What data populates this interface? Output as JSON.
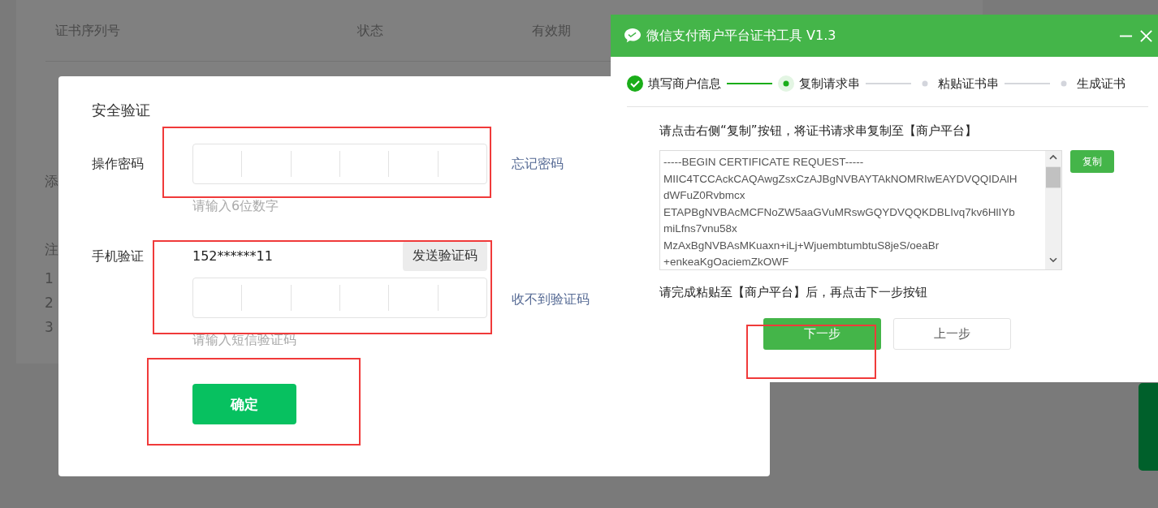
{
  "background": {
    "columns": [
      "证书序列号",
      "状态",
      "有效期"
    ],
    "fragments": [
      "添",
      "注",
      "1",
      "2",
      "3"
    ]
  },
  "dialog": {
    "title": "安全验证",
    "password": {
      "label": "操作密码",
      "hint": "请输入6位数字",
      "link": "忘记密码"
    },
    "phone": {
      "label": "手机验证",
      "number": "152******11",
      "send_button": "发送验证码",
      "hint": "请输入短信验证码",
      "link": "收不到验证码"
    },
    "confirm_button": "确定"
  },
  "tool": {
    "title": "微信支付商户平台证书工具 V1.3",
    "steps": [
      {
        "label": "填写商户信息",
        "completed": true,
        "selected": false
      },
      {
        "label": "复制请求串",
        "completed": false,
        "selected": true
      },
      {
        "label": "粘贴证书串",
        "completed": false,
        "selected": false
      },
      {
        "label": "生成证书",
        "completed": false,
        "selected": false
      }
    ],
    "instruction": "请点击右侧“复制”按钮，将证书请求串复制至【商户平台】",
    "request_lines": [
      "-----BEGIN CERTIFICATE REQUEST-----",
      "MIIC4TCCAckCAQAwgZsxCzAJBgNVBAYTAkNOMRIwEAYDVQQIDAlH",
      "dWFuZ0Rvbmcx",
      "ETAPBgNVBAcMCFNoZW5aaGVuMRswGQYDVQQKDBLIvq7kv6HlIYb",
      "miLfns7vnu58x",
      "MzAxBgNVBAsMKuaxn+iLj+WjuembtumbtuS8jeS/oeaBr",
      "+enkeaKgOaciemZkOWF"
    ],
    "copy_button": "复制",
    "note": "请完成粘贴至【商户平台】后，再点击下一步按钮",
    "buttons": [
      {
        "label": "下一步",
        "kind": "primary"
      },
      {
        "label": "上一步",
        "kind": "secondary"
      }
    ]
  }
}
